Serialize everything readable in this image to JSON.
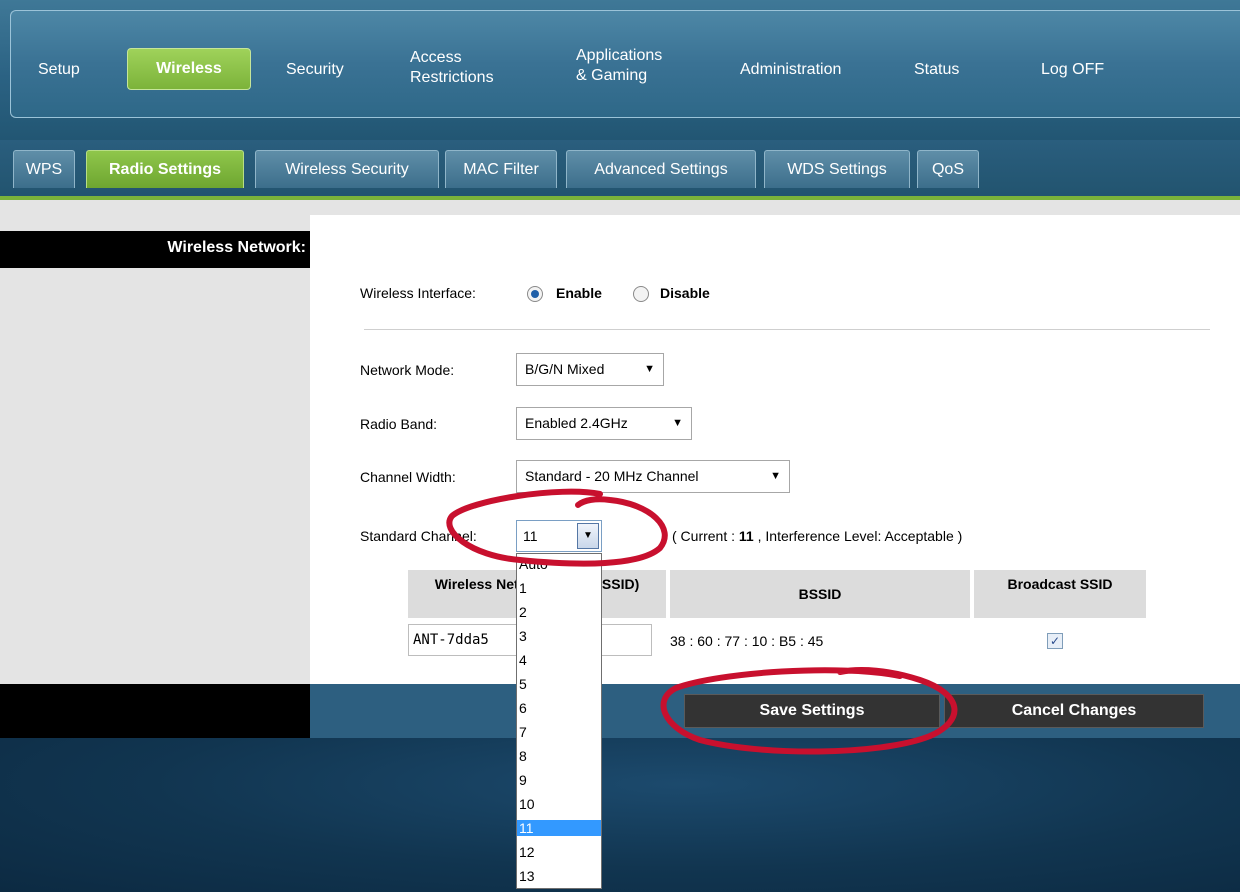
{
  "top_nav": {
    "items": [
      {
        "label": "Setup"
      },
      {
        "label": "Wireless",
        "active": true
      },
      {
        "label": "Security"
      },
      {
        "label": "Access\nRestrictions"
      },
      {
        "label": "Applications\n& Gaming"
      },
      {
        "label": "Administration"
      },
      {
        "label": "Status"
      },
      {
        "label": "Log OFF"
      }
    ]
  },
  "sub_tabs": {
    "items": [
      {
        "label": "WPS"
      },
      {
        "label": "Radio Settings",
        "active": true
      },
      {
        "label": "Wireless Security"
      },
      {
        "label": "MAC Filter"
      },
      {
        "label": "Advanced Settings"
      },
      {
        "label": "WDS Settings"
      },
      {
        "label": "QoS"
      }
    ]
  },
  "side": {
    "label": "Wireless Network:"
  },
  "form": {
    "interface_label": "Wireless Interface:",
    "enable_label": "Enable",
    "disable_label": "Disable",
    "interface_value": "Enable",
    "network_mode_label": "Network Mode:",
    "network_mode_value": "B/G/N Mixed",
    "radio_band_label": "Radio Band:",
    "radio_band_value": "Enabled 2.4GHz",
    "channel_width_label": "Channel Width:",
    "channel_width_value": "Standard - 20 MHz Channel",
    "standard_channel_label": "Standard Channel:",
    "standard_channel_value": "11",
    "current_prefix": "( Current : ",
    "current_value": "11",
    "current_suffix": " , Interference Level: Acceptable )"
  },
  "table": {
    "col_name": "Wireless Network Name (SSID)",
    "col_bssid": "BSSID",
    "col_broadcast": "Broadcast SSID",
    "row": {
      "ssid": "ANT-7dda5",
      "bssid": "38 : 60 : 77 : 10 : B5 : 45",
      "broadcast_checked": true
    }
  },
  "buttons": {
    "save": "Save Settings",
    "cancel": "Cancel Changes"
  },
  "channel_dropdown": {
    "options": [
      "Auto",
      "1",
      "2",
      "3",
      "4",
      "5",
      "6",
      "7",
      "8",
      "9",
      "10",
      "11",
      "12",
      "13"
    ],
    "selected": "11"
  },
  "colors": {
    "accent_green": "#7ab33a",
    "nav_blue": "#2b6283",
    "annotation_red": "#c8102e",
    "dropdown_highlight": "#3399ff"
  },
  "icons": {
    "select_arrow": "chevron-down-icon",
    "checkbox_mark": "check-icon"
  }
}
